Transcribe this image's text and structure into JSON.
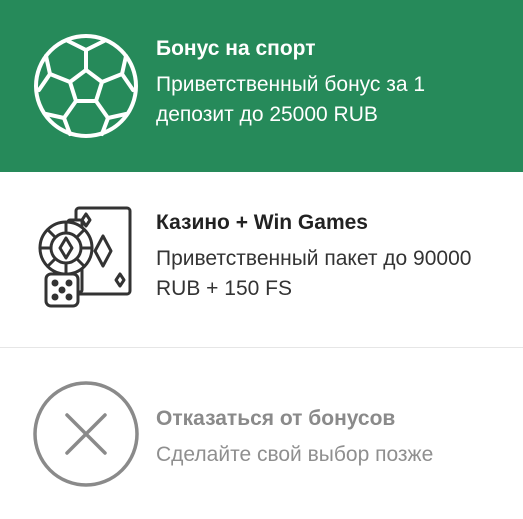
{
  "options": [
    {
      "id": "sport",
      "title": "Бонус на спорт",
      "description": "Приветственный бонус за 1 депозит до 25000 RUB",
      "icon": "soccer-ball-icon",
      "background": "#268a5a",
      "selected": true
    },
    {
      "id": "casino",
      "title": "Казино + Win Games",
      "description": "Приветственный пакет до 90000 RUB + 150 FS",
      "icon": "casino-cards-chip-dice-icon",
      "background": "#ffffff",
      "selected": false
    },
    {
      "id": "none",
      "title": "Отказаться от бонусов",
      "description": "Сделайте свой выбор позже",
      "icon": "close-circle-icon",
      "background": "#ffffff",
      "selected": false
    }
  ],
  "colors": {
    "accent_green": "#268a5a",
    "text_dark": "#222222",
    "text_muted": "#8a8a8a",
    "divider": "#e6e6e6"
  }
}
